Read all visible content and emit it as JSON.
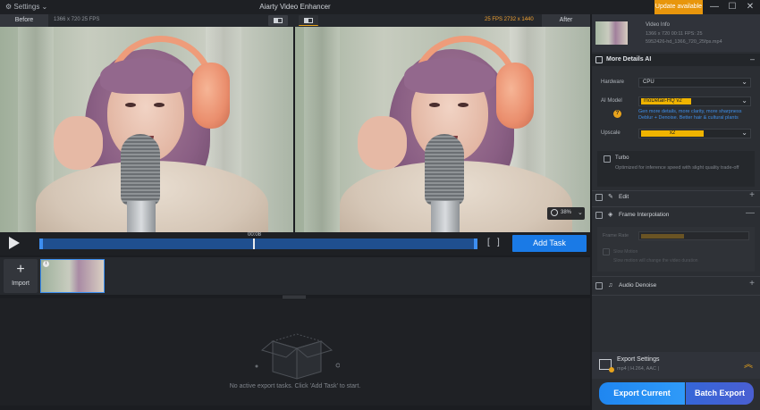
{
  "titlebar": {
    "settings_label": "Settings",
    "settings_chevron": "⌄",
    "title": "Aiarty Video Enhancer",
    "update_label": "Update available",
    "minimize": "—",
    "maximize": "☐",
    "close": "✕"
  },
  "compare": {
    "before_label": "Before",
    "before_info": "1366 x 720  25 FPS",
    "after_info": "25 FPS  2732 x 1440",
    "after_label": "After",
    "zoom_value": "38%",
    "zoom_chevron": "⌄"
  },
  "timeline": {
    "time": "00:08",
    "bracket_in": "[",
    "bracket_out": "]",
    "add_task_label": "Add Task"
  },
  "clips": {
    "import_plus": "+",
    "import_label": "Import",
    "thumb_info": "i"
  },
  "export_area": {
    "empty_message": "No active export tasks. Click 'Add Task' to start."
  },
  "sidebar": {
    "video_info": {
      "title": "Video Info",
      "line1": "1366 x 720  00:11  FPS: 25",
      "line2": "5952426-hd_1366_720_25fps.mp4"
    },
    "more_details": {
      "title": "More Details AI",
      "collapse": "–"
    },
    "hardware": {
      "label": "Hardware",
      "value": "CPU",
      "chevron": "⌄"
    },
    "ai_model": {
      "label": "AI Model",
      "value": "moDetail-HQ  v2",
      "chevron": "⌄",
      "help": "?",
      "desc_line1": "Gen more details, more clarity, more sharpness",
      "desc_line2": "Deblur + Denoise. Better hair & cultural plants"
    },
    "upscale": {
      "label": "Upscale",
      "value": "x2",
      "chevron": "⌄"
    },
    "turbo": {
      "title": "Turbo",
      "desc": "Optimized for inference speed with slight quality trade-off"
    },
    "edit": {
      "label": "Edit",
      "icon_glyph": "✎",
      "plus": "+"
    },
    "frame_interpolation": {
      "label": "Frame Interpolation",
      "icon_glyph": "◈",
      "collapse": "—",
      "frame_rate_label": "Frame Rate",
      "slow_motion_label": "Slow Motion",
      "slow_motion_desc": "Slow motion will change the video duration"
    },
    "audio_denoise": {
      "label": "Audio Denoise",
      "icon_glyph": "♫",
      "plus": "+"
    },
    "export_settings": {
      "title": "Export Settings",
      "subtitle": "mp4 | H.264, AAC |",
      "chevron": "︽"
    },
    "export_current_label": "Export Current",
    "batch_export_label": "Batch Export"
  }
}
